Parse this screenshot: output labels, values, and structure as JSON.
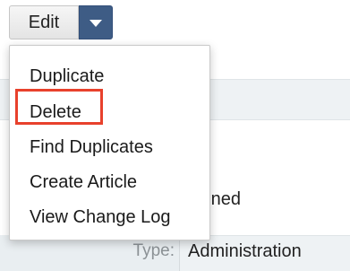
{
  "toolbar": {
    "edit_label": "Edit",
    "caret_icon": "chevron-down-icon"
  },
  "menu": {
    "items": [
      {
        "label": "Duplicate"
      },
      {
        "label": "Delete",
        "highlighted": true
      },
      {
        "label": "Find Duplicates"
      },
      {
        "label": "Create Article"
      },
      {
        "label": "View Change Log"
      }
    ],
    "highlight_color": "#e8412c"
  },
  "record": {
    "assigned_text": "signed",
    "type_label": "Type:",
    "type_value": "Administration"
  },
  "colors": {
    "caret_button": "#3e5c85",
    "panel_band": "#eef2f4"
  }
}
